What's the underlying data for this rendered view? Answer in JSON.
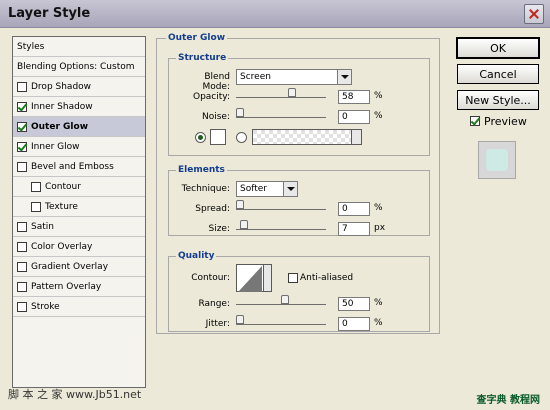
{
  "window": {
    "title": "Layer Style"
  },
  "styles": {
    "items": [
      {
        "label": "Styles",
        "checked": null
      },
      {
        "label": "Blending Options: Custom",
        "checked": null
      },
      {
        "label": "Drop Shadow",
        "checked": false
      },
      {
        "label": "Inner Shadow",
        "checked": true
      },
      {
        "label": "Outer Glow",
        "checked": true
      },
      {
        "label": "Inner Glow",
        "checked": true
      },
      {
        "label": "Bevel and Emboss",
        "checked": false
      },
      {
        "label": "Contour",
        "checked": false
      },
      {
        "label": "Texture",
        "checked": false
      },
      {
        "label": "Satin",
        "checked": false
      },
      {
        "label": "Color Overlay",
        "checked": false
      },
      {
        "label": "Gradient Overlay",
        "checked": false
      },
      {
        "label": "Pattern Overlay",
        "checked": false
      },
      {
        "label": "Stroke",
        "checked": false
      }
    ]
  },
  "outer_glow": {
    "title": "Outer Glow",
    "structure": {
      "title": "Structure",
      "blend_mode_label": "Blend Mode:",
      "blend_mode_value": "Screen",
      "opacity_label": "Opacity:",
      "opacity_value": "58",
      "opacity_unit": "%",
      "noise_label": "Noise:",
      "noise_value": "0",
      "noise_unit": "%"
    },
    "elements": {
      "title": "Elements",
      "technique_label": "Technique:",
      "technique_value": "Softer",
      "spread_label": "Spread:",
      "spread_value": "0",
      "spread_unit": "%",
      "size_label": "Size:",
      "size_value": "7",
      "size_unit": "px"
    },
    "quality": {
      "title": "Quality",
      "contour_label": "Contour:",
      "anti_aliased_label": "Anti-aliased",
      "range_label": "Range:",
      "range_value": "50",
      "range_unit": "%",
      "jitter_label": "Jitter:",
      "jitter_value": "0",
      "jitter_unit": "%"
    }
  },
  "buttons": {
    "ok": "OK",
    "cancel": "Cancel",
    "new_style": "New Style...",
    "preview": "Preview"
  },
  "watermarks": {
    "left": "脚 本 之 家  www.Jb51.net",
    "right": "查字典 教程网"
  }
}
